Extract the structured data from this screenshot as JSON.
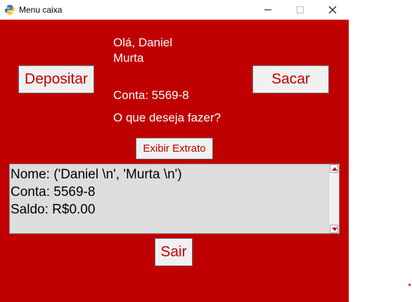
{
  "window": {
    "title": "Menu caixa",
    "icons": {
      "app": "python-icon",
      "minimize": "minimize-icon",
      "maximize": "maximize-icon",
      "close": "close-icon"
    }
  },
  "greeting": "Olá, Daniel\nMurta",
  "account_label": "Conta: 5569-8",
  "question": "O que deseja fazer?",
  "buttons": {
    "deposit": "Depositar",
    "withdraw": "Sacar",
    "statement": "Exibir Extrato",
    "exit": "Sair"
  },
  "statement_box": {
    "lines": [
      "Nome: ('Daniel \\n', 'Murta \\n')",
      "Conta: 5569-8",
      "Saldo: R$0.00"
    ]
  },
  "colors": {
    "background": "#c00000",
    "button_text": "#c00000",
    "text": "#ffffff"
  }
}
